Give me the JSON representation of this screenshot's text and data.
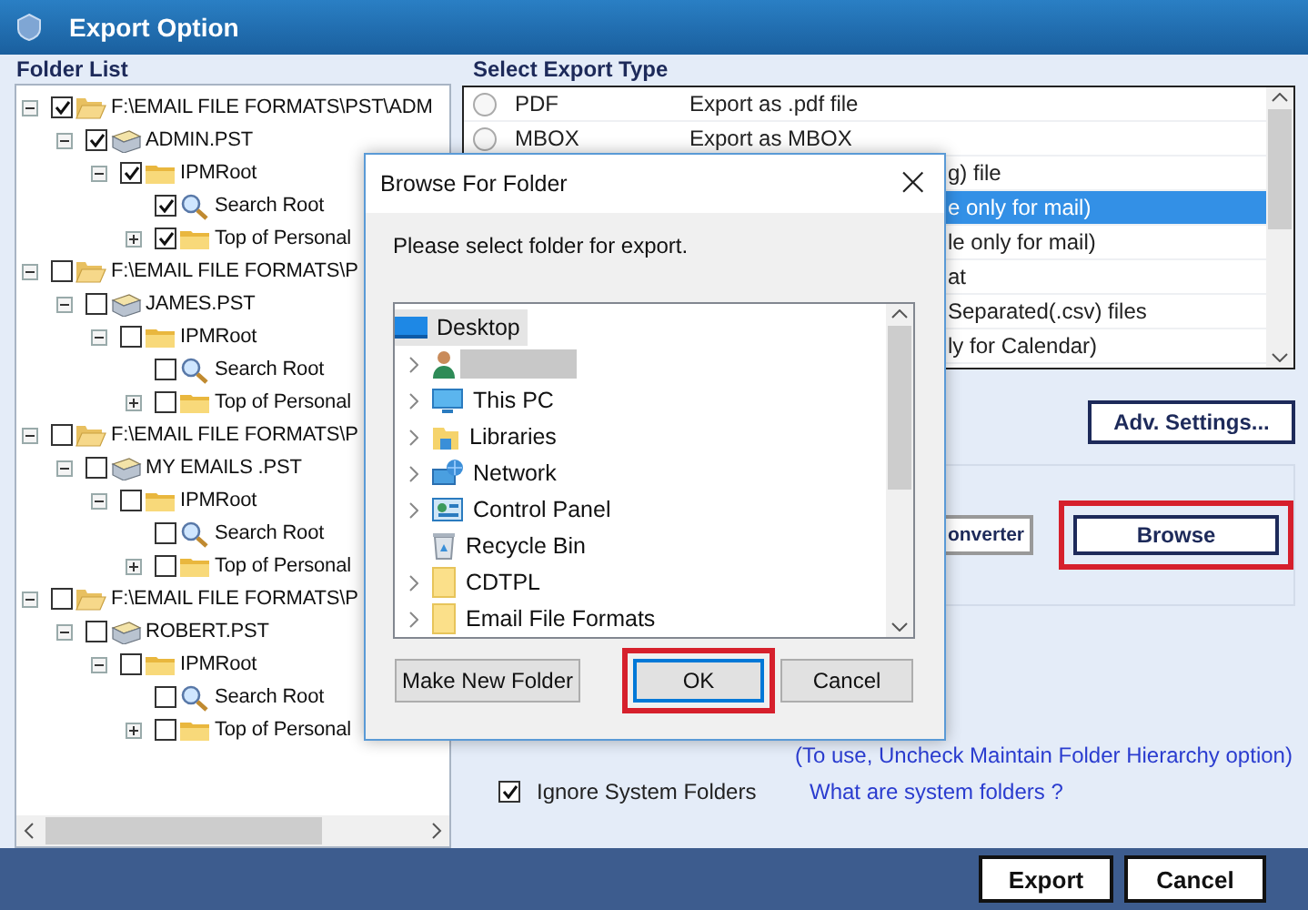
{
  "window": {
    "title": "Export Option"
  },
  "folder_list": {
    "title": "Folder List",
    "tree": [
      {
        "label": "F:\\EMAIL FILE FORMATS\\PST\\ADM",
        "kind": "drive",
        "checked": true,
        "expanded": true,
        "children": [
          {
            "label": "ADMIN.PST",
            "kind": "pst",
            "checked": true,
            "expanded": true,
            "children": [
              {
                "label": "IPMRoot",
                "kind": "folder",
                "checked": true,
                "expanded": true,
                "children": [
                  {
                    "label": "Search Root",
                    "kind": "search",
                    "checked": true
                  },
                  {
                    "label": "Top of Personal",
                    "kind": "folder",
                    "checked": true,
                    "expanded": false
                  }
                ]
              }
            ]
          }
        ]
      },
      {
        "label": "F:\\EMAIL FILE FORMATS\\P",
        "kind": "drive",
        "checked": false,
        "expanded": true,
        "children": [
          {
            "label": "JAMES.PST",
            "kind": "pst",
            "checked": false,
            "expanded": true,
            "children": [
              {
                "label": "IPMRoot",
                "kind": "folder",
                "checked": false,
                "expanded": true,
                "children": [
                  {
                    "label": "Search Root",
                    "kind": "search",
                    "checked": false
                  },
                  {
                    "label": "Top of Personal",
                    "kind": "folder",
                    "checked": false,
                    "expanded": false
                  }
                ]
              }
            ]
          }
        ]
      },
      {
        "label": "F:\\EMAIL FILE FORMATS\\P",
        "kind": "drive",
        "checked": false,
        "expanded": true,
        "children": [
          {
            "label": "MY EMAILS .PST",
            "kind": "pst",
            "checked": false,
            "expanded": true,
            "children": [
              {
                "label": "IPMRoot",
                "kind": "folder",
                "checked": false,
                "expanded": true,
                "children": [
                  {
                    "label": "Search Root",
                    "kind": "search",
                    "checked": false
                  },
                  {
                    "label": "Top of Personal",
                    "kind": "folder",
                    "checked": false,
                    "expanded": false
                  }
                ]
              }
            ]
          }
        ]
      },
      {
        "label": "F:\\EMAIL FILE FORMATS\\P",
        "kind": "drive",
        "checked": false,
        "expanded": true,
        "children": [
          {
            "label": "ROBERT.PST",
            "kind": "pst",
            "checked": false,
            "expanded": true,
            "children": [
              {
                "label": "IPMRoot",
                "kind": "folder",
                "checked": false,
                "expanded": true,
                "children": [
                  {
                    "label": "Search Root",
                    "kind": "search",
                    "checked": false
                  },
                  {
                    "label": "Top of Personal",
                    "kind": "folder",
                    "checked": false,
                    "expanded": false
                  }
                ]
              }
            ]
          }
        ]
      }
    ]
  },
  "export_type": {
    "title": "Select Export Type",
    "rows": [
      {
        "type": "PDF",
        "description": "Export as .pdf file",
        "selected": false
      },
      {
        "type": "MBOX",
        "description": "Export as MBOX",
        "selected": false
      },
      {
        "description": "g) file",
        "selected": false
      },
      {
        "description": "e only for mail)",
        "selected": true
      },
      {
        "description": "le only for mail)",
        "selected": false
      },
      {
        "description": "at",
        "selected": false
      },
      {
        "description": "Separated(.csv) files",
        "selected": false
      },
      {
        "description": "ly for Calendar)",
        "selected": false
      }
    ]
  },
  "adv_settings_button": "Adv. Settings...",
  "converter_button": "onverter",
  "browse_button": "Browse",
  "hierarchy_link": "(To use, Uncheck Maintain Folder Hierarchy option)",
  "ignore_system_folders": {
    "label": "Ignore System Folders",
    "checked": true
  },
  "system_folders_link": "What are system folders ?",
  "footer_buttons": [
    "Export",
    "Cancel"
  ],
  "dialog": {
    "title": "Browse For Folder",
    "close": "×",
    "prompt": "Please select folder for export.",
    "items": [
      {
        "label": "Desktop",
        "kind": "desktop",
        "selected": true
      },
      {
        "kind": "user",
        "expanded": false,
        "selected": false
      },
      {
        "label": "This PC",
        "kind": "pc",
        "expanded": false,
        "selected": false
      },
      {
        "label": "Libraries",
        "kind": "libraries",
        "expanded": false,
        "selected": false
      },
      {
        "label": "Network",
        "kind": "network",
        "expanded": false,
        "selected": false
      },
      {
        "label": "Control Panel",
        "kind": "control-panel",
        "expanded": false,
        "selected": false
      },
      {
        "label": "Recycle Bin",
        "kind": "recycle-bin",
        "selected": false
      },
      {
        "label": "CDTPL",
        "kind": "folder",
        "expanded": false,
        "selected": false
      },
      {
        "label": "Email File Formats",
        "kind": "folder",
        "expanded": false,
        "selected": false
      }
    ],
    "buttons": [
      "Make New Folder",
      "OK",
      "Cancel"
    ]
  }
}
